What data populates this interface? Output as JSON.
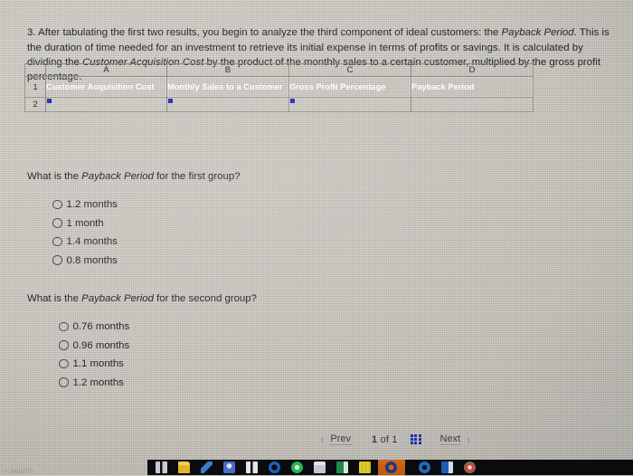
{
  "page": {
    "background_color": "#c6c3ba",
    "accent_blue": "#1f2fb4"
  },
  "intro": {
    "number": "3.",
    "part1": "After tabulating the first two results, you begin to analyze the third component of ideal customers: the ",
    "em1": "Payback Period",
    "part2": ". This is the duration of time needed for an investment to retrieve its initial expense in terms of profits or savings. It is calculated by dividing the ",
    "em2": "Customer Acquisition Cost",
    "part3": " by the product of the monthly sales to a certain customer, multiplied by the gross profit percentage."
  },
  "spreadsheet": {
    "column_letters": [
      "A",
      "B",
      "C",
      "D"
    ],
    "row_numbers": [
      "1",
      "2"
    ],
    "header_row": [
      "Customer Acquisition Cost",
      "Monthly Sales to a Customer",
      "Gross Profit Percentage",
      "Payback Period"
    ],
    "input_row": [
      "",
      "",
      "",
      ""
    ]
  },
  "questions": [
    {
      "prefix": "What is the ",
      "em": "Payback Period",
      "suffix": " for the first group?",
      "options": [
        "1.2 months",
        "1 month",
        "1.4 months",
        "0.8 months"
      ]
    },
    {
      "prefix": "What is the ",
      "em": "Payback Period",
      "suffix": " for the second group?",
      "options": [
        "0.76 months",
        "0.96 months",
        "1.1 months",
        "1.2 months"
      ]
    }
  ],
  "pagination": {
    "prev_arrow": "‹",
    "prev_label": "Prev",
    "count_current": "1",
    "count_sep": "of",
    "count_total": "1",
    "grid_icon": "grid-icon",
    "next_label": "Next",
    "next_arrow": "›"
  },
  "desktop": {
    "search_ghost": "⌕ search",
    "taskbar_icons": [
      {
        "name": "task-view-icon",
        "color": "#cfd2d8"
      },
      {
        "name": "file-explorer-icon",
        "color": "#f3c33b"
      },
      {
        "name": "pen-tool-icon",
        "color": "#3f7fd0"
      },
      {
        "name": "teams-icon",
        "color": "#4a6fd0"
      },
      {
        "name": "bluetooth-devices-icon",
        "color": "#e9edf3"
      },
      {
        "name": "cortana-icon",
        "color": "#1c63c8"
      },
      {
        "name": "whatsapp-icon",
        "color": "#1fc04c"
      },
      {
        "name": "microsoft-store-icon",
        "color": "#e8ebef"
      },
      {
        "name": "excel-icon",
        "color": "#1d8f4e"
      },
      {
        "name": "sticky-notes-icon",
        "color": "#e5d228"
      },
      {
        "name": "chegg-icon",
        "color": "#d96a18"
      },
      {
        "name": "edge-icon",
        "color": "#1e6fc4"
      },
      {
        "name": "word-icon",
        "color": "#1f5fbd"
      },
      {
        "name": "chrome-icon",
        "color": "#e2443b"
      }
    ]
  }
}
